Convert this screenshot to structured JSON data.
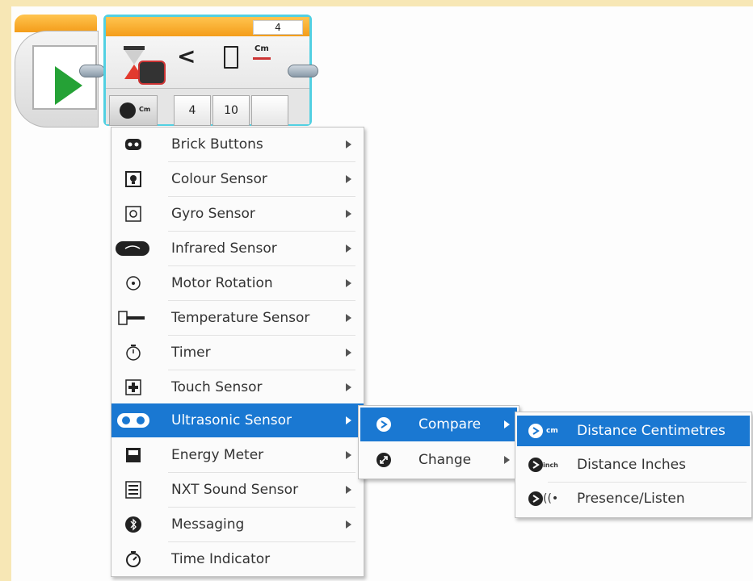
{
  "wait_block": {
    "header_value": "4",
    "compare_sign": "<",
    "unit_label": "Cm",
    "mode_unit": "Cm",
    "inputs": [
      "4",
      "10"
    ]
  },
  "main_menu": {
    "items": [
      {
        "label": "Brick Buttons",
        "icon": "brick-buttons-icon",
        "has_submenu": true
      },
      {
        "label": "Colour Sensor",
        "icon": "colour-sensor-icon",
        "has_submenu": true
      },
      {
        "label": "Gyro Sensor",
        "icon": "gyro-sensor-icon",
        "has_submenu": true
      },
      {
        "label": "Infrared Sensor",
        "icon": "infrared-sensor-icon",
        "has_submenu": true
      },
      {
        "label": "Motor Rotation",
        "icon": "motor-rotation-icon",
        "has_submenu": true
      },
      {
        "label": "Temperature Sensor",
        "icon": "temperature-sensor-icon",
        "has_submenu": true
      },
      {
        "label": "Timer",
        "icon": "timer-icon",
        "has_submenu": true
      },
      {
        "label": "Touch Sensor",
        "icon": "touch-sensor-icon",
        "has_submenu": true
      },
      {
        "label": "Ultrasonic Sensor",
        "icon": "ultrasonic-sensor-icon",
        "has_submenu": true,
        "active": true
      },
      {
        "label": "Energy Meter",
        "icon": "energy-meter-icon",
        "has_submenu": true
      },
      {
        "label": "NXT Sound Sensor",
        "icon": "nxt-sound-sensor-icon",
        "has_submenu": true
      },
      {
        "label": "Messaging",
        "icon": "bluetooth-icon",
        "has_submenu": true
      },
      {
        "label": "Time Indicator",
        "icon": "time-indicator-icon",
        "has_submenu": false
      }
    ]
  },
  "sub_menu": {
    "items": [
      {
        "label": "Compare",
        "icon": "compare-icon",
        "active": true
      },
      {
        "label": "Change",
        "icon": "change-icon",
        "active": false
      }
    ]
  },
  "compare_menu": {
    "items": [
      {
        "label": "Distance Centimetres",
        "unit": "cm",
        "icon": "distance-cm-icon",
        "active": true
      },
      {
        "label": "Distance Inches",
        "unit": "inch",
        "icon": "distance-inch-icon",
        "active": false
      },
      {
        "label": "Presence/Listen",
        "unit": "((•",
        "icon": "presence-icon",
        "active": false
      }
    ]
  },
  "colors": {
    "highlight": "#1a78d2",
    "block_orange": "#f49d1a",
    "selection_cyan": "#52d0e2",
    "start_green": "#25a236"
  }
}
